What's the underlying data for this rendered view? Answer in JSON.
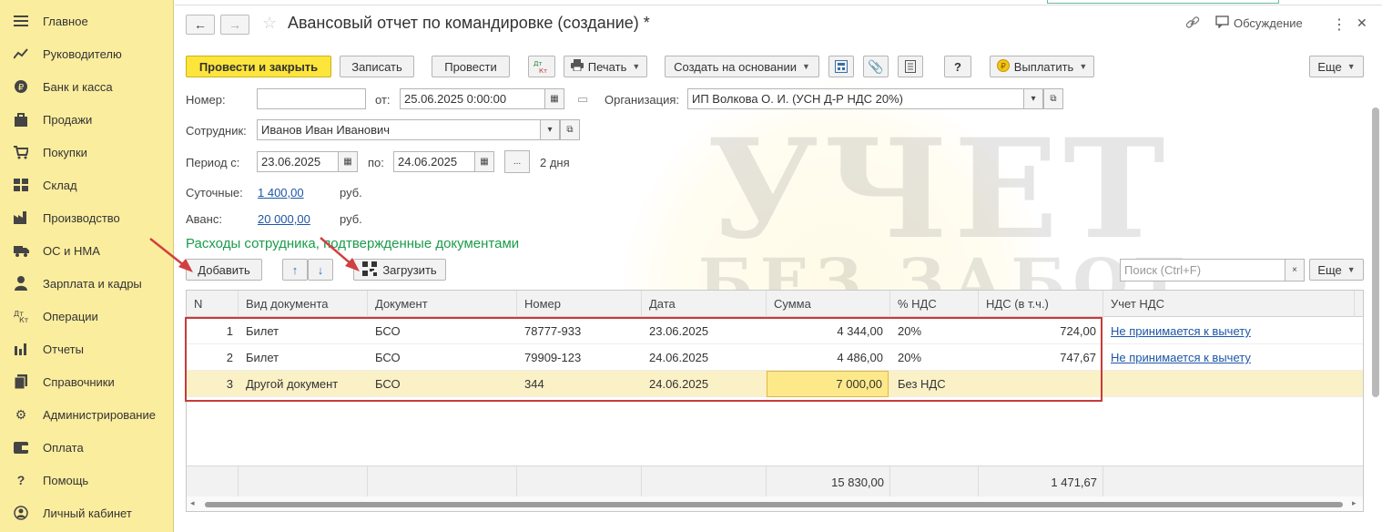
{
  "sidebar": {
    "items": [
      {
        "label": "Главное",
        "icon": "menu-icon"
      },
      {
        "label": "Руководителю",
        "icon": "trend-icon"
      },
      {
        "label": "Банк и касса",
        "icon": "ruble-icon"
      },
      {
        "label": "Продажи",
        "icon": "bag-icon"
      },
      {
        "label": "Покупки",
        "icon": "cart-icon"
      },
      {
        "label": "Склад",
        "icon": "warehouse-icon"
      },
      {
        "label": "Производство",
        "icon": "factory-icon"
      },
      {
        "label": "ОС и НМА",
        "icon": "truck-icon"
      },
      {
        "label": "Зарплата и кадры",
        "icon": "person-icon"
      },
      {
        "label": "Операции",
        "icon": "dt-kt-icon"
      },
      {
        "label": "Отчеты",
        "icon": "bar-chart-icon"
      },
      {
        "label": "Справочники",
        "icon": "book-icon"
      },
      {
        "label": "Администрирование",
        "icon": "gear-icon"
      },
      {
        "label": "Оплата",
        "icon": "wallet-icon"
      },
      {
        "label": "Помощь",
        "icon": "question-icon"
      },
      {
        "label": "Личный кабинет",
        "icon": "user-circle-icon"
      }
    ]
  },
  "header": {
    "back": "←",
    "forward": "→",
    "title": "Авансовый отчет по командировке (создание) *",
    "discussion": "Обсуждение",
    "more": "⋮",
    "close": "✕"
  },
  "toolbar": {
    "post_close": "Провести и закрыть",
    "save": "Записать",
    "post": "Провести",
    "dtkt": "Дт Кт",
    "print": "Печать",
    "create_based": "Создать на основании",
    "help": "?",
    "pay": "Выплатить",
    "more": "Еще"
  },
  "form": {
    "number_label": "Номер:",
    "number_value": "",
    "date_label": "от:",
    "date_value": "25.06.2025  0:00:00",
    "org_label": "Организация:",
    "org_value": "ИП Волкова О. И. (УСН Д-Р НДС 20%)",
    "employee_label": "Сотрудник:",
    "employee_value": "Иванов Иван Иванович",
    "period_label": "Период с:",
    "period_from": "23.06.2025",
    "period_to_label": "по:",
    "period_to": "24.06.2025",
    "period_btn": "...",
    "period_days": "2 дня",
    "per_diem_label": "Суточные:",
    "per_diem_value": "1 400,00",
    "per_diem_unit": "руб.",
    "advance_label": "Аванс:",
    "advance_value": "20 000,00",
    "advance_unit": "руб."
  },
  "section": {
    "title": "Расходы сотрудника, подтвержденные документами",
    "add": "Добавить",
    "up": "↑",
    "down": "↓",
    "load": "Загрузить",
    "search_placeholder": "Поиск (Ctrl+F)",
    "search_clear": "×",
    "more": "Еще"
  },
  "table": {
    "columns": [
      "N",
      "Вид документа",
      "Документ",
      "Номер",
      "Дата",
      "Сумма",
      "% НДС",
      "НДС (в т.ч.)",
      "Учет НДС"
    ],
    "rows": [
      {
        "n": "1",
        "kind": "Билет",
        "doc": "БСО",
        "num": "78777-933",
        "date": "23.06.2025",
        "sum": "4 344,00",
        "vat_rate": "20%",
        "vat": "724,00",
        "vat_acc": "Не принимается к вычету"
      },
      {
        "n": "2",
        "kind": "Билет",
        "doc": "БСО",
        "num": "79909-123",
        "date": "24.06.2025",
        "sum": "4 486,00",
        "vat_rate": "20%",
        "vat": "747,67",
        "vat_acc": "Не принимается к вычету"
      },
      {
        "n": "3",
        "kind": "Другой документ",
        "doc": "БСО",
        "num": "344",
        "date": "24.06.2025",
        "sum": "7 000,00",
        "vat_rate": "Без НДС",
        "vat": "",
        "vat_acc": ""
      }
    ],
    "total_sum": "15 830,00",
    "total_vat": "1 471,67"
  },
  "watermark": {
    "line1": "УЧЕТ",
    "line2": "БЕЗ ЗАБОТ"
  },
  "colors": {
    "sidebar_bg": "#fbed9e",
    "primary_button": "#fde53b",
    "section_title": "#1a9c4a",
    "link": "#1d56a6",
    "annotation_red": "#c73b3b",
    "selected_row": "#fbf1c6"
  }
}
